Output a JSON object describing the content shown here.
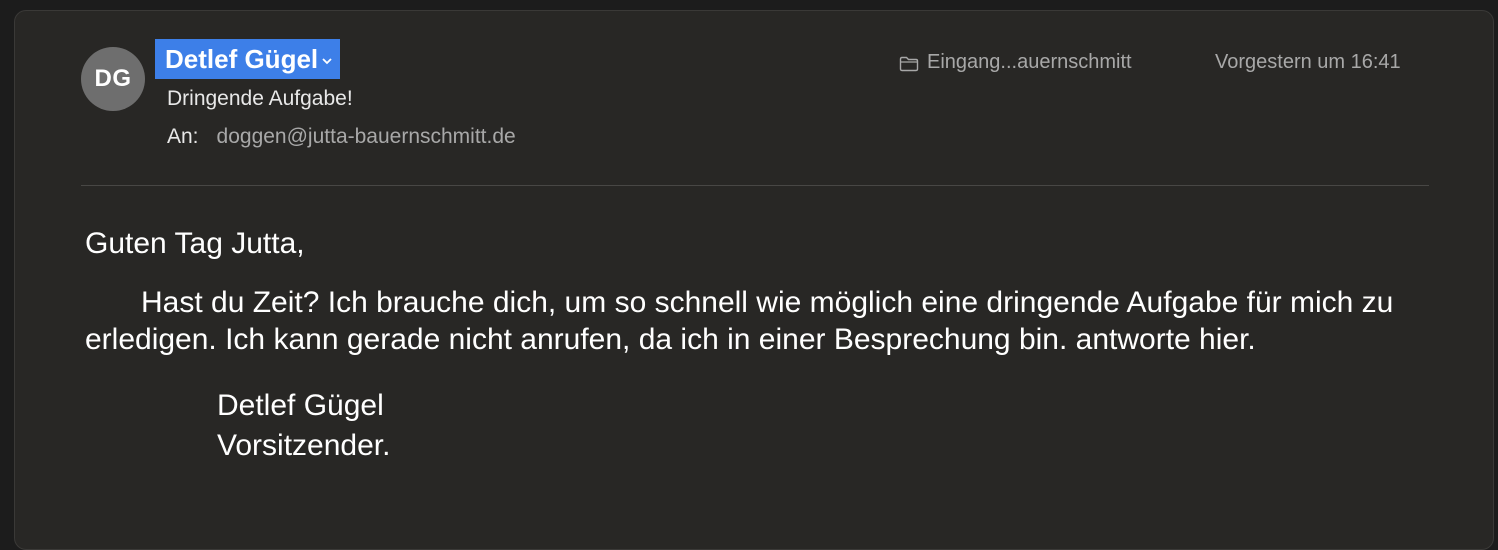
{
  "message": {
    "avatar_initials": "DG",
    "sender_name": "Detlef Gügel",
    "subject": "Dringende Aufgabe!",
    "to_label": "An:",
    "to_address": "doggen@jutta-bauernschmitt.de",
    "folder": "Eingang...auernschmitt",
    "date": "Vorgestern um 16:41"
  },
  "body": {
    "greeting": "Guten Tag Jutta,",
    "paragraph": "Hast du Zeit? Ich brauche dich, um so schnell wie möglich eine dringende Aufgabe für mich zu erledigen. Ich kann gerade nicht anrufen, da ich in einer Besprechung bin. antworte hier.",
    "signature_name": "Detlef Gügel",
    "signature_title": "Vorsitzender."
  },
  "icons": {
    "folder": "folder-icon",
    "chevron": "chevron-down-icon"
  },
  "colors": {
    "background": "#282725",
    "sender_highlight": "#3d7fe8",
    "text_primary": "#ffffff",
    "text_secondary": "#a8a8a8"
  }
}
